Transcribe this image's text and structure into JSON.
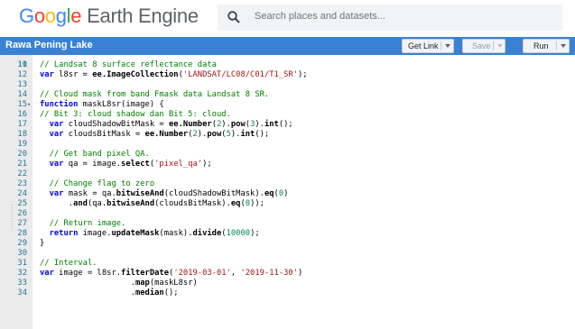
{
  "header": {
    "logo_letters": [
      "G",
      "o",
      "o",
      "g",
      "l",
      "e"
    ],
    "logo_rest": "Earth Engine",
    "search_placeholder": "Search places and datasets..."
  },
  "toolbar": {
    "script_title": "Rawa Pening Lake",
    "get_link_label": "Get Link",
    "save_label": "Save",
    "run_label": "Run"
  },
  "editor": {
    "first_line_number": "10",
    "lines": [
      {
        "n": "11",
        "fold": "",
        "tokens": [
          [
            "cm",
            "// Landsat 8 surface reflectance data"
          ]
        ]
      },
      {
        "n": "12",
        "fold": "",
        "tokens": [
          [
            "kw",
            "var"
          ],
          [
            "plain",
            " l8sr = "
          ],
          [
            "fn",
            "ee.ImageCollection"
          ],
          [
            "plain",
            "("
          ],
          [
            "st",
            "'LANDSAT/LC08/C01/T1_SR'"
          ],
          [
            "plain",
            ");"
          ]
        ]
      },
      {
        "n": "13",
        "fold": "",
        "tokens": []
      },
      {
        "n": "14",
        "fold": "",
        "tokens": [
          [
            "cm",
            "// Cloud mask from band Fmask data Landsat 8 SR."
          ]
        ]
      },
      {
        "n": "15",
        "fold": "▾",
        "tokens": [
          [
            "kw",
            "function"
          ],
          [
            "plain",
            " maskL8sr(image) {"
          ]
        ]
      },
      {
        "n": "16",
        "fold": "",
        "tokens": [
          [
            "cm",
            "// Bit 3: cloud shadow dan Bit 5: cloud."
          ]
        ]
      },
      {
        "n": "17",
        "fold": "",
        "tokens": [
          [
            "plain",
            "  "
          ],
          [
            "kw",
            "var"
          ],
          [
            "plain",
            " cloudShadowBitMask = "
          ],
          [
            "fn",
            "ee.Number"
          ],
          [
            "plain",
            "("
          ],
          [
            "nm",
            "2"
          ],
          [
            "plain",
            ")."
          ],
          [
            "fn",
            "pow"
          ],
          [
            "plain",
            "("
          ],
          [
            "nm",
            "3"
          ],
          [
            "plain",
            ")."
          ],
          [
            "fn",
            "int"
          ],
          [
            "plain",
            "();"
          ]
        ]
      },
      {
        "n": "18",
        "fold": "",
        "tokens": [
          [
            "plain",
            "  "
          ],
          [
            "kw",
            "var"
          ],
          [
            "plain",
            " cloudsBitMask = "
          ],
          [
            "fn",
            "ee.Number"
          ],
          [
            "plain",
            "("
          ],
          [
            "nm",
            "2"
          ],
          [
            "plain",
            ")."
          ],
          [
            "fn",
            "pow"
          ],
          [
            "plain",
            "("
          ],
          [
            "nm",
            "5"
          ],
          [
            "plain",
            ")."
          ],
          [
            "fn",
            "int"
          ],
          [
            "plain",
            "();"
          ]
        ]
      },
      {
        "n": "19",
        "fold": "",
        "tokens": []
      },
      {
        "n": "20",
        "fold": "",
        "tokens": [
          [
            "plain",
            "  "
          ],
          [
            "cm",
            "// Get band pixel QA."
          ]
        ]
      },
      {
        "n": "21",
        "fold": "",
        "tokens": [
          [
            "plain",
            "  "
          ],
          [
            "kw",
            "var"
          ],
          [
            "plain",
            " qa = image."
          ],
          [
            "fn",
            "select"
          ],
          [
            "plain",
            "("
          ],
          [
            "st",
            "'pixel_qa'"
          ],
          [
            "plain",
            ");"
          ]
        ]
      },
      {
        "n": "22",
        "fold": "",
        "tokens": []
      },
      {
        "n": "23",
        "fold": "",
        "tokens": [
          [
            "plain",
            "  "
          ],
          [
            "cm",
            "// Change flag to zero"
          ]
        ]
      },
      {
        "n": "24",
        "fold": "",
        "tokens": [
          [
            "plain",
            "  "
          ],
          [
            "kw",
            "var"
          ],
          [
            "plain",
            " mask = qa."
          ],
          [
            "fn",
            "bitwiseAnd"
          ],
          [
            "plain",
            "(cloudShadowBitMask)."
          ],
          [
            "fn",
            "eq"
          ],
          [
            "plain",
            "("
          ],
          [
            "nm",
            "0"
          ],
          [
            "plain",
            ")"
          ]
        ]
      },
      {
        "n": "25",
        "fold": "",
        "tokens": [
          [
            "plain",
            "      ."
          ],
          [
            "fn",
            "and"
          ],
          [
            "plain",
            "(qa."
          ],
          [
            "fn",
            "bitwiseAnd"
          ],
          [
            "plain",
            "(cloudsBitMask)."
          ],
          [
            "fn",
            "eq"
          ],
          [
            "plain",
            "("
          ],
          [
            "nm",
            "0"
          ],
          [
            "plain",
            "));"
          ]
        ]
      },
      {
        "n": "26",
        "fold": "",
        "tokens": []
      },
      {
        "n": "27",
        "fold": "",
        "tokens": [
          [
            "plain",
            "  "
          ],
          [
            "cm",
            "// Return image."
          ]
        ]
      },
      {
        "n": "28",
        "fold": "",
        "tokens": [
          [
            "plain",
            "  "
          ],
          [
            "kw",
            "return"
          ],
          [
            "plain",
            " image."
          ],
          [
            "fn",
            "updateMask"
          ],
          [
            "plain",
            "(mask)."
          ],
          [
            "fn",
            "divide"
          ],
          [
            "plain",
            "("
          ],
          [
            "nm",
            "10000"
          ],
          [
            "plain",
            ");"
          ]
        ]
      },
      {
        "n": "29",
        "fold": "",
        "tokens": [
          [
            "plain",
            "}"
          ]
        ]
      },
      {
        "n": "30",
        "fold": "",
        "tokens": []
      },
      {
        "n": "31",
        "fold": "",
        "tokens": [
          [
            "cm",
            "// Interval."
          ]
        ]
      },
      {
        "n": "32",
        "fold": "",
        "tokens": [
          [
            "kw",
            "var"
          ],
          [
            "plain",
            " image = l8sr."
          ],
          [
            "fn",
            "filterDate"
          ],
          [
            "plain",
            "("
          ],
          [
            "st",
            "'2019-03-01'"
          ],
          [
            "plain",
            ", "
          ],
          [
            "st",
            "'2019-11-30'"
          ],
          [
            "plain",
            ")"
          ]
        ]
      },
      {
        "n": "33",
        "fold": "",
        "tokens": [
          [
            "plain",
            "                   ."
          ],
          [
            "fn",
            "map"
          ],
          [
            "plain",
            "(maskL8sr)"
          ]
        ]
      },
      {
        "n": "34",
        "fold": "",
        "tokens": [
          [
            "plain",
            "                   ."
          ],
          [
            "fn",
            "median"
          ],
          [
            "plain",
            "();"
          ]
        ]
      }
    ]
  }
}
